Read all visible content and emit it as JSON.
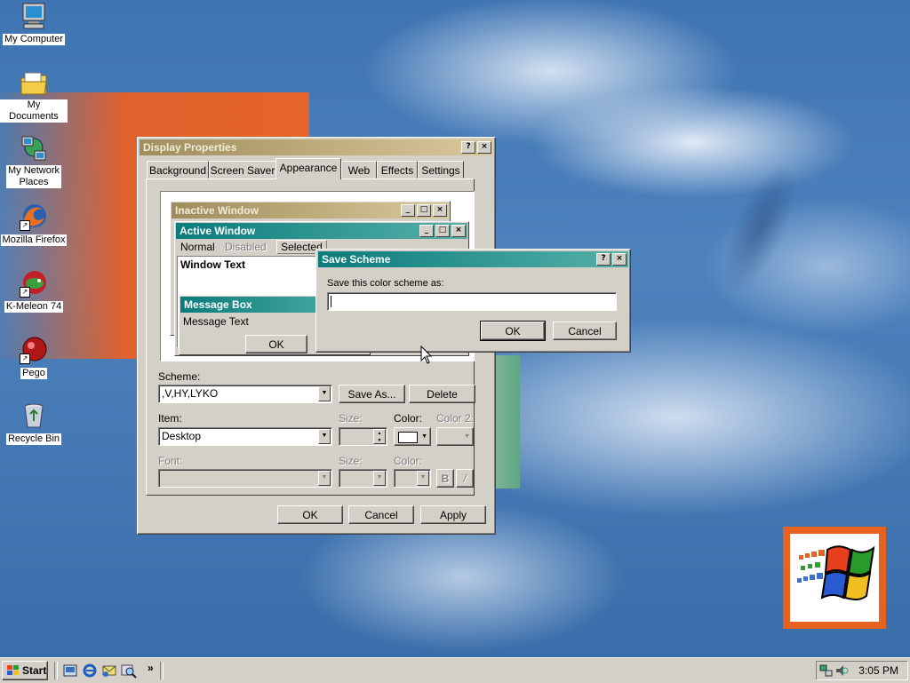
{
  "desktop": {
    "icons": [
      {
        "label": "My Computer",
        "icon": "computer-icon"
      },
      {
        "label": "My Documents",
        "icon": "folder-icon"
      },
      {
        "label": "My Network Places",
        "label2": "Places",
        "label1": "My Network",
        "icon": "network-icon"
      },
      {
        "label": "Mozilla Firefox",
        "icon": "firefox-icon"
      },
      {
        "label": "K-Meleon 74",
        "icon": "kmeleon-icon"
      },
      {
        "label": "Pego",
        "icon": "pego-icon"
      },
      {
        "label": "Recycle Bin",
        "icon": "recycle-bin-icon"
      }
    ]
  },
  "display_properties": {
    "title": "Display Properties",
    "help": "?",
    "close": "×",
    "tabs": [
      "Background",
      "Screen Saver",
      "Appearance",
      "Web",
      "Effects",
      "Settings"
    ],
    "selected_tab": "Appearance",
    "preview": {
      "inactive_title": "Inactive Window",
      "active_title": "Active Window",
      "menu_normal": "Normal",
      "menu_disabled": "Disabled",
      "menu_selected": "Selected",
      "window_text": "Window Text",
      "msgbox_title": "Message Box",
      "msgbox_text": "Message Text",
      "msgbox_ok": "OK"
    },
    "scheme_label": "Scheme:",
    "scheme_value": ",V,HY,LYKO",
    "save_as": "Save As...",
    "delete": "Delete",
    "item_label": "Item:",
    "item_value": "Desktop",
    "size_label": "Size:",
    "color_label": "Color:",
    "color2_label": "Color 2:",
    "font_label": "Font:",
    "font_size_label": "Size:",
    "font_color_label": "Color:",
    "bold": "B",
    "italic": "/",
    "ok": "OK",
    "cancel": "Cancel",
    "apply": "Apply"
  },
  "save_scheme": {
    "title": "Save Scheme",
    "help": "?",
    "close": "×",
    "prompt": "Save this color scheme as:",
    "input_value": "",
    "ok": "OK",
    "cancel": "Cancel"
  },
  "taskbar": {
    "start": "Start",
    "chevron": "»",
    "clock": "3:05 PM"
  },
  "colors": {
    "active_title": "#0a7c7c",
    "inactive_title": "#a08d5d",
    "face": "#d4d0c8",
    "desktop": "#3e74b2"
  }
}
